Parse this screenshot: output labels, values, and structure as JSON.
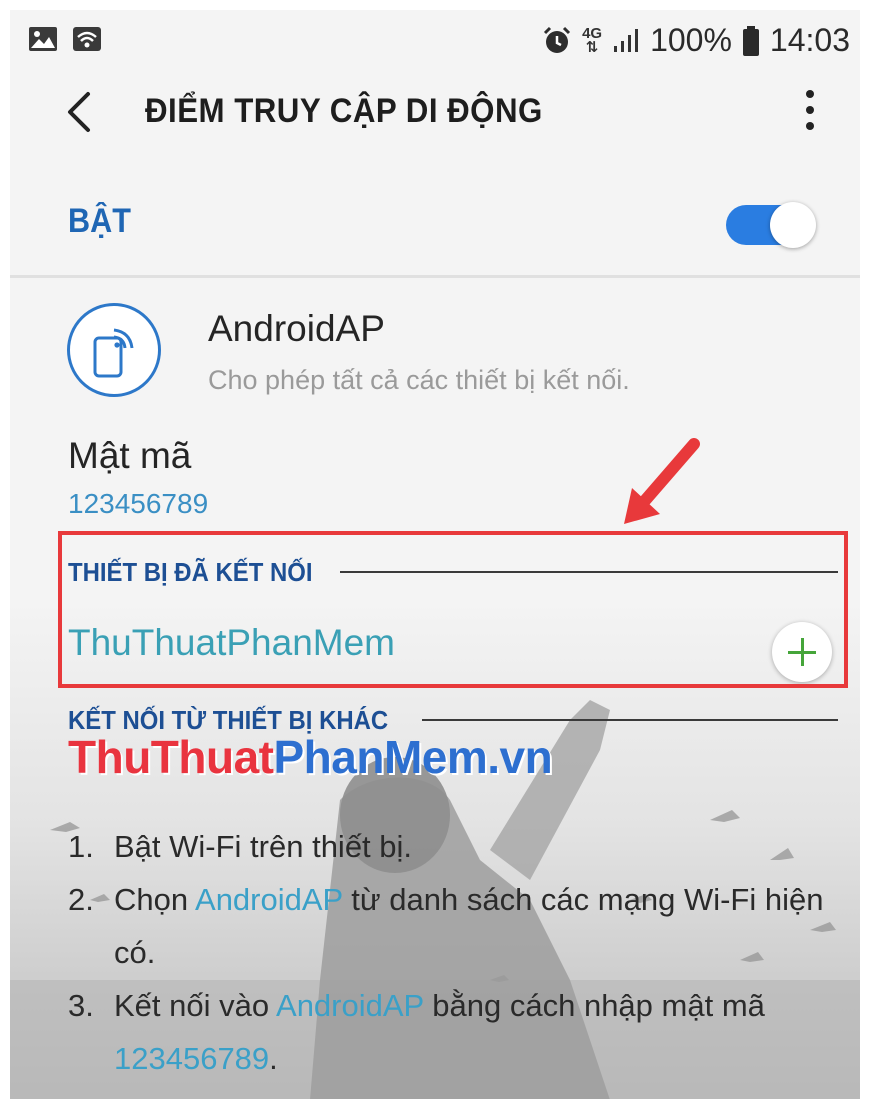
{
  "status_bar": {
    "network": "4G",
    "battery": "100%",
    "time": "14:03"
  },
  "app_bar": {
    "title": "ĐIỂM TRUY CẬP DI ĐỘNG"
  },
  "hotspot_toggle": {
    "label": "BẬT",
    "on": true,
    "accent": "#2a7de1"
  },
  "access_point": {
    "name": "AndroidAP",
    "description": "Cho phép tất cả các thiết bị kết nối."
  },
  "password": {
    "label": "Mật mã",
    "value": "123456789"
  },
  "connected_section": {
    "title": "THIẾT BỊ ĐÃ KẾT NỐI",
    "devices": [
      "ThuThuatPhanMem"
    ]
  },
  "other_section": {
    "title": "KẾT NỐI TỪ THIẾT BỊ KHÁC"
  },
  "watermark": {
    "part1": "ThuThuat",
    "part2": "PhanMem.vn"
  },
  "steps": [
    {
      "num": "1.",
      "pre": "Bật Wi-Fi trên thiết bị.",
      "hl1": "",
      "mid": "",
      "hl2": "",
      "post": ""
    },
    {
      "num": "2.",
      "pre": "Chọn ",
      "hl1": "AndroidAP",
      "mid": " từ danh sách các mạng Wi-Fi hiện có.",
      "hl2": "",
      "post": ""
    },
    {
      "num": "3.",
      "pre": "Kết nối vào ",
      "hl1": "AndroidAP",
      "mid": " bằng cách nhập mật mã ",
      "hl2": "123456789",
      "post": "."
    }
  ],
  "colors": {
    "section_title": "#1d4f94",
    "link": "#3aa0c8",
    "highlight_box": "#e8393b",
    "add_icon": "#45a53a"
  }
}
